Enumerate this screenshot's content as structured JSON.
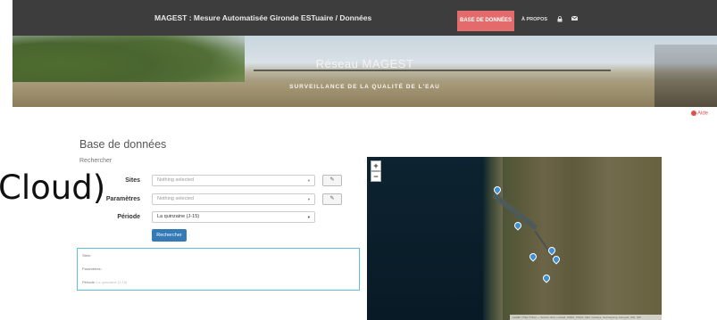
{
  "navbar": {
    "title": "MAGEST : Mesure Automatisée Gironde ESTuaire / Données",
    "active_item": "BASE DE DONNÉES",
    "about_item": "À PROPOS",
    "lock_icon": "lock-icon",
    "mail_icon": "envelope-icon",
    "active_color": "#e36b6b",
    "background_color": "#3d3d3d"
  },
  "banner": {
    "title": "Réseau MAGEST",
    "subtitle": "SURVEILLANCE DE LA QUALITÉ DE L'EAU"
  },
  "help": {
    "label": "Aide",
    "icon": "question-circle-icon",
    "color": "#d9534f"
  },
  "page": {
    "title": "Base de données",
    "subtitle": "Rechercher"
  },
  "form": {
    "sites_label": "Sites",
    "sites_placeholder": "Nothing selected",
    "parameters_label": "Paramètres",
    "parameters_placeholder": "Nothing selected",
    "period_label": "Période",
    "period_value": "La quinzaine (J-15)",
    "edit_icon": "edit-icon",
    "search_button": "Rechercher",
    "button_color": "#337ab7"
  },
  "summary": {
    "sites_label": "Sites:",
    "parameters_label": "Paramètres:",
    "period_label": "Période:",
    "period_value": "La quinzaine (J-15)",
    "border_color": "#5bc0de"
  },
  "map": {
    "zoom_in": "+",
    "zoom_out": "−",
    "marker_count": 6,
    "attribution": "Leaflet | Tiles © Esri — Source: Esri, i-cubed, USDA, USGS, AEX, GeoEye, Getmapping, Aerogrid, IGN, IGP"
  },
  "overlay": {
    "text": "Cloud)"
  }
}
